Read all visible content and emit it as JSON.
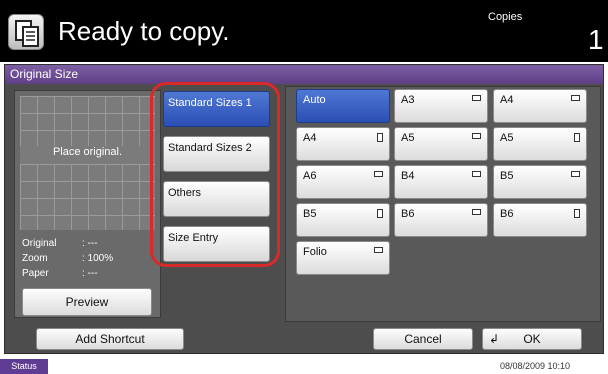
{
  "header": {
    "title": "Ready to copy.",
    "copies_label": "Copies",
    "copies_count": "1",
    "icon": "copy-icon"
  },
  "panel": {
    "title": "Original Size"
  },
  "preview": {
    "placeholder": "Place original.",
    "original_label": "Original",
    "original_value": ": ---",
    "zoom_label": "Zoom",
    "zoom_value": ": 100%",
    "paper_label": "Paper",
    "paper_value": ": ---",
    "preview_button": "Preview"
  },
  "categories": [
    {
      "label": "Standard Sizes 1",
      "selected": true
    },
    {
      "label": "Standard Sizes 2",
      "selected": false
    },
    {
      "label": "Others",
      "selected": false
    },
    {
      "label": "Size Entry",
      "selected": false
    }
  ],
  "sizes": [
    {
      "label": "Auto",
      "orientation": "",
      "selected": true
    },
    {
      "label": "A3",
      "orientation": "landscape",
      "selected": false
    },
    {
      "label": "A4",
      "orientation": "landscape",
      "selected": false
    },
    {
      "label": "A4",
      "orientation": "portrait",
      "selected": false
    },
    {
      "label": "A5",
      "orientation": "landscape",
      "selected": false
    },
    {
      "label": "A5",
      "orientation": "portrait",
      "selected": false
    },
    {
      "label": "A6",
      "orientation": "landscape",
      "selected": false
    },
    {
      "label": "B4",
      "orientation": "landscape",
      "selected": false
    },
    {
      "label": "B5",
      "orientation": "landscape",
      "selected": false
    },
    {
      "label": "B5",
      "orientation": "portrait",
      "selected": false
    },
    {
      "label": "B6",
      "orientation": "landscape",
      "selected": false
    },
    {
      "label": "B6",
      "orientation": "portrait",
      "selected": false
    },
    {
      "label": "Folio",
      "orientation": "landscape",
      "selected": false
    }
  ],
  "bottom": {
    "add_shortcut": "Add Shortcut",
    "cancel": "Cancel",
    "ok": "OK",
    "ok_icon": "return-arrow-icon"
  },
  "status": {
    "button": "Status",
    "datetime": "08/08/2009   10:10"
  },
  "colors": {
    "selected": "#3a62c8",
    "highlight_outline": "#d92a2a",
    "title_bar": "#6a4a95"
  }
}
